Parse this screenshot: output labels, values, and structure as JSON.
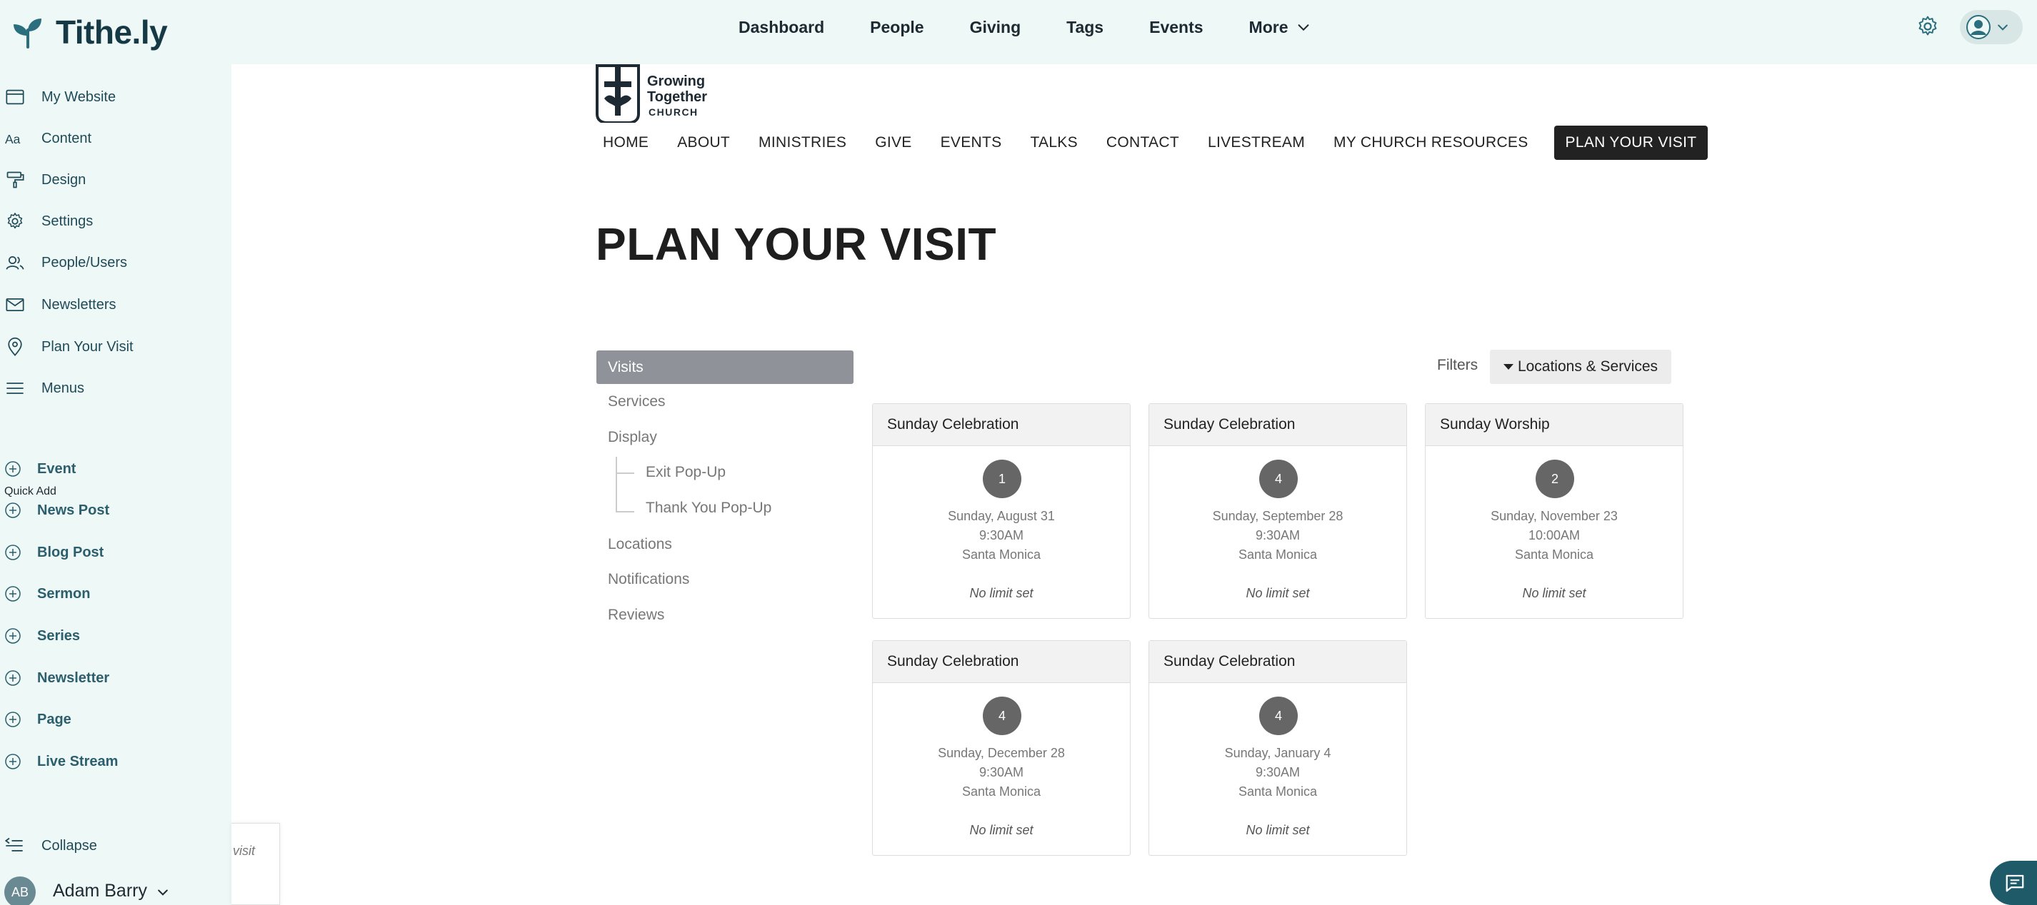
{
  "app": {
    "brand": "Tithe.ly",
    "brand_color": "#163a45"
  },
  "topnav": {
    "items": [
      "Dashboard",
      "People",
      "Giving",
      "Tags",
      "Events"
    ],
    "more_label": "More"
  },
  "sidebar": {
    "items": [
      {
        "label": "My Website",
        "icon": "browser-window-icon"
      },
      {
        "label": "Content",
        "icon": "font-aa-icon"
      },
      {
        "label": "Design",
        "icon": "paint-roller-icon"
      },
      {
        "label": "Settings",
        "icon": "gear-icon"
      },
      {
        "label": "People/Users",
        "icon": "users-icon"
      },
      {
        "label": "Newsletters",
        "icon": "envelope-icon"
      },
      {
        "label": "Plan Your Visit",
        "icon": "map-pin-icon"
      },
      {
        "label": "Menus",
        "icon": "hamburger-menu-icon"
      }
    ],
    "quick_add_label": "Quick Add",
    "quick_add": [
      "Event",
      "News Post",
      "Blog Post",
      "Sermon",
      "Series",
      "Newsletter",
      "Page",
      "Live Stream"
    ],
    "collapse_label": "Collapse",
    "account": {
      "initials": "AB",
      "name": "Adam Barry"
    }
  },
  "partial_popup": {
    "text": "visit"
  },
  "site": {
    "logo": {
      "line1": "Growing",
      "line2": "Together",
      "line3": "CHURCH"
    },
    "nav": [
      "HOME",
      "ABOUT",
      "MINISTRIES",
      "GIVE",
      "EVENTS",
      "TALKS",
      "CONTACT",
      "LIVESTREAM",
      "MY CHURCH RESOURCES"
    ],
    "nav_cta": "PLAN YOUR VISIT",
    "heading": "PLAN YOUR VISIT"
  },
  "visits_menu": {
    "active": "Visits",
    "services": "Services",
    "display": "Display",
    "display_children": [
      "Exit Pop-Up",
      "Thank You Pop-Up"
    ],
    "locations": "Locations",
    "notifications": "Notifications",
    "reviews": "Reviews"
  },
  "filters": {
    "label": "Filters",
    "button": "Locations & Services"
  },
  "cards": [
    {
      "title": "Sunday Celebration",
      "count": "1",
      "date": "Sunday, August 31",
      "time": "9:30AM",
      "location": "Santa Monica",
      "limit": "No limit set"
    },
    {
      "title": "Sunday Celebration",
      "count": "4",
      "date": "Sunday, September 28",
      "time": "9:30AM",
      "location": "Santa Monica",
      "limit": "No limit set"
    },
    {
      "title": "Sunday Worship",
      "count": "2",
      "date": "Sunday, November 23",
      "time": "10:00AM",
      "location": "Santa Monica",
      "limit": "No limit set"
    },
    {
      "title": "Sunday Celebration",
      "count": "4",
      "date": "Sunday, December 28",
      "time": "9:30AM",
      "location": "Santa Monica",
      "limit": "No limit set"
    },
    {
      "title": "Sunday Celebration",
      "count": "4",
      "date": "Sunday, January 4",
      "time": "9:30AM",
      "location": "Santa Monica",
      "limit": "No limit set"
    }
  ],
  "colors": {
    "sidebar_bg": "#eef8f7",
    "sidebar_text": "#1f4a58",
    "quick_add_text": "#2c5f6e",
    "active_menu": "#8f9399",
    "badge": "#666666",
    "chat": "#1f5a68"
  }
}
